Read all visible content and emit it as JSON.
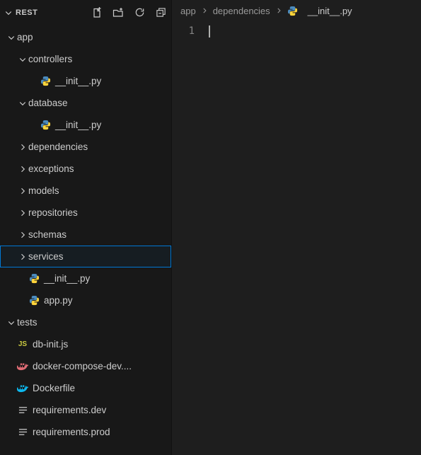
{
  "explorer": {
    "title": "REST",
    "items": [
      {
        "type": "folder",
        "label": "app",
        "depth": 0,
        "expanded": true
      },
      {
        "type": "folder",
        "label": "controllers",
        "depth": 1,
        "expanded": true
      },
      {
        "type": "file",
        "label": "__init__.py",
        "depth": 2,
        "icon": "python"
      },
      {
        "type": "folder",
        "label": "database",
        "depth": 1,
        "expanded": true
      },
      {
        "type": "file",
        "label": "__init__.py",
        "depth": 2,
        "icon": "python"
      },
      {
        "type": "folder",
        "label": "dependencies",
        "depth": 1,
        "expanded": false
      },
      {
        "type": "folder",
        "label": "exceptions",
        "depth": 1,
        "expanded": false
      },
      {
        "type": "folder",
        "label": "models",
        "depth": 1,
        "expanded": false
      },
      {
        "type": "folder",
        "label": "repositories",
        "depth": 1,
        "expanded": false
      },
      {
        "type": "folder",
        "label": "schemas",
        "depth": 1,
        "expanded": false
      },
      {
        "type": "folder",
        "label": "services",
        "depth": 1,
        "expanded": false,
        "selected": true
      },
      {
        "type": "file",
        "label": "__init__.py",
        "depth": 1,
        "icon": "python"
      },
      {
        "type": "file",
        "label": "app.py",
        "depth": 1,
        "icon": "python"
      },
      {
        "type": "folder",
        "label": "tests",
        "depth": 0,
        "expanded": true
      },
      {
        "type": "file",
        "label": "db-init.js",
        "depth": 0,
        "icon": "js"
      },
      {
        "type": "file",
        "label": "docker-compose-dev....",
        "depth": 0,
        "icon": "docker-compose"
      },
      {
        "type": "file",
        "label": "Dockerfile",
        "depth": 0,
        "icon": "docker"
      },
      {
        "type": "file",
        "label": "requirements.dev",
        "depth": 0,
        "icon": "lines"
      },
      {
        "type": "file",
        "label": "requirements.prod",
        "depth": 0,
        "icon": "lines"
      }
    ]
  },
  "breadcrumbs": {
    "segments": [
      "app",
      "dependencies"
    ],
    "file": "__init__.py",
    "fileIcon": "python"
  },
  "editor": {
    "lineNumber": "1"
  }
}
